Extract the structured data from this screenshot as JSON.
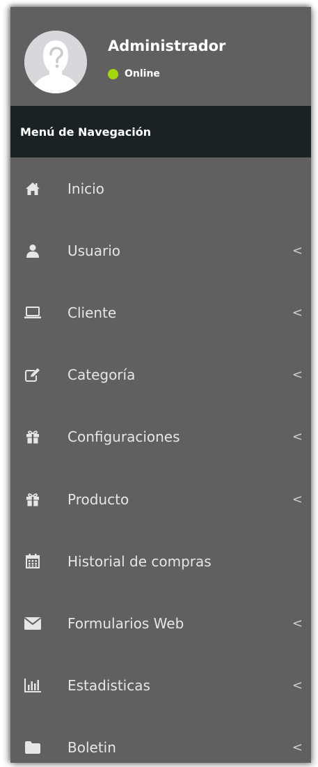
{
  "user": {
    "name": "Administrador",
    "status": "Online",
    "status_color": "#a2d80f",
    "avatar_icon": "user-silhouette-icon"
  },
  "nav": {
    "header": "Menú de Navegación",
    "chevron_glyph": "<",
    "items": [
      {
        "label": "Inicio",
        "icon": "home-icon",
        "has_submenu": false
      },
      {
        "label": "Usuario",
        "icon": "user-icon",
        "has_submenu": true
      },
      {
        "label": "Cliente",
        "icon": "laptop-icon",
        "has_submenu": true
      },
      {
        "label": "Categoría",
        "icon": "edit-icon",
        "has_submenu": true
      },
      {
        "label": "Configuraciones",
        "icon": "gift-icon",
        "has_submenu": true
      },
      {
        "label": "Producto",
        "icon": "gift-icon",
        "has_submenu": true
      },
      {
        "label": "Historial de compras",
        "icon": "calendar-icon",
        "has_submenu": false
      },
      {
        "label": "Formularios Web",
        "icon": "envelope-icon",
        "has_submenu": true
      },
      {
        "label": "Estadisticas",
        "icon": "bar-chart-icon",
        "has_submenu": true
      },
      {
        "label": "Boletin",
        "icon": "folder-icon",
        "has_submenu": true
      }
    ]
  },
  "colors": {
    "sidebar_bg": "#606060",
    "header_bg": "#1a2226",
    "icon_color": "#e6e6e6"
  }
}
